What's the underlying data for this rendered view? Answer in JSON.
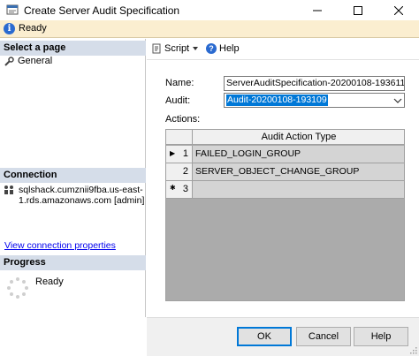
{
  "window": {
    "title": "Create Server Audit Specification",
    "status": "Ready"
  },
  "left_pane": {
    "select_page_header": "Select a page",
    "pages": [
      {
        "label": "General",
        "icon": "wrench-icon"
      }
    ],
    "connection_header": "Connection",
    "connection_text": "sqlshack.cumznii9fba.us-east-1.rds.amazonaws.com [admin]",
    "view_connection_link": "View connection properties",
    "progress_header": "Progress",
    "progress_status": "Ready"
  },
  "toolbar": {
    "script_label": "Script",
    "help_label": "Help"
  },
  "form": {
    "name_label": "Name:",
    "name_value": "ServerAuditSpecification-20200108-193611",
    "audit_label": "Audit:",
    "audit_value": "Audit-20200108-193109",
    "actions_label": "Actions:"
  },
  "grid": {
    "column_header": "Audit Action Type",
    "rows": [
      {
        "num": "1",
        "indicator": "▶",
        "value": "FAILED_LOGIN_GROUP"
      },
      {
        "num": "2",
        "indicator": "",
        "value": "SERVER_OBJECT_CHANGE_GROUP"
      },
      {
        "num": "3",
        "indicator": "✱",
        "value": ""
      }
    ]
  },
  "buttons": {
    "ok": "OK",
    "cancel": "Cancel",
    "help": "Help"
  },
  "colors": {
    "section_header_bg": "#d5dde9",
    "status_bar_bg": "#fbeed0",
    "selection_blue": "#0078d7",
    "grid_background": "#ababab"
  }
}
